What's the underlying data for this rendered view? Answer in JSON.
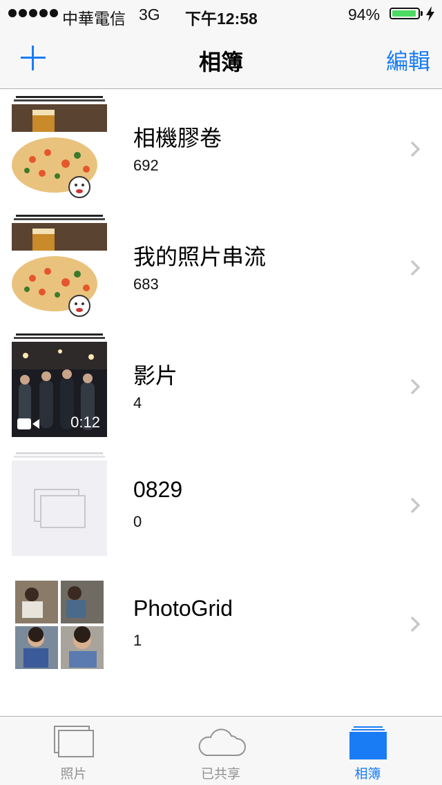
{
  "status_bar": {
    "carrier": "中華電信",
    "network": "3G",
    "time": "下午12:58",
    "battery": "94%",
    "battery_level": 0.94
  },
  "nav": {
    "title": "相簿",
    "edit_label": "編輯",
    "add_icon": "plus-icon"
  },
  "albums": [
    {
      "name": "相機膠卷",
      "count": "692"
    },
    {
      "name": "我的照片串流",
      "count": "683"
    },
    {
      "name": "影片",
      "count": "4",
      "duration": "0:12"
    },
    {
      "name": "0829",
      "count": "0"
    },
    {
      "name": "PhotoGrid",
      "count": "1"
    }
  ],
  "tabs": [
    {
      "label": "照片",
      "icon": "photos-icon",
      "active": false
    },
    {
      "label": "已共享",
      "icon": "cloud-icon",
      "active": false
    },
    {
      "label": "相簿",
      "icon": "albums-icon",
      "active": true
    }
  ],
  "colors": {
    "accent": "#1a7cf5",
    "battery": "#4cd964",
    "bar_bg": "#f7f7f7",
    "inactive_tab": "#929292"
  }
}
